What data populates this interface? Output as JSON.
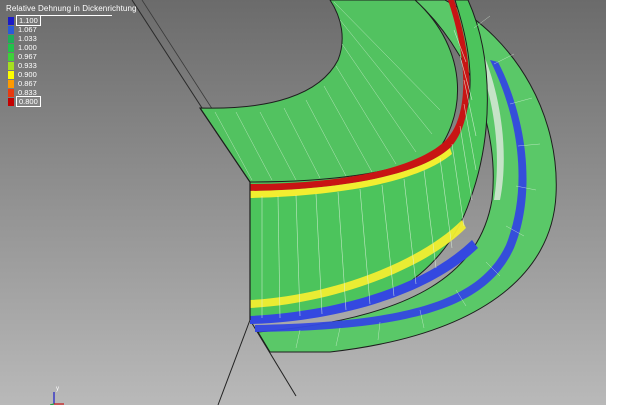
{
  "legend": {
    "title": "Relative Dehnung in Dickenrichtung",
    "entries": [
      {
        "label": "1.100",
        "color": "#1a1ac8",
        "boxed": true
      },
      {
        "label": "1.067",
        "color": "#2a5ad8",
        "boxed": false
      },
      {
        "label": "1.033",
        "color": "#1fae58",
        "boxed": false
      },
      {
        "label": "1.000",
        "color": "#22c24a",
        "boxed": false
      },
      {
        "label": "0.967",
        "color": "#3ed13a",
        "boxed": false
      },
      {
        "label": "0.933",
        "color": "#a6e020",
        "boxed": false
      },
      {
        "label": "0.900",
        "color": "#ffff00",
        "boxed": false
      },
      {
        "label": "0.867",
        "color": "#ff9a00",
        "boxed": false
      },
      {
        "label": "0.833",
        "color": "#e83a10",
        "boxed": false
      },
      {
        "label": "0.800",
        "color": "#c40000",
        "boxed": true
      }
    ]
  },
  "triad": {
    "axis_label": "y"
  },
  "colors": {
    "model_green": "#4cc45c",
    "model_green_light": "#7ad488",
    "band_red": "#c81414",
    "band_yellow": "#f2ee30",
    "band_blue": "#3448e0",
    "edge_line": "#1f1f1f"
  }
}
